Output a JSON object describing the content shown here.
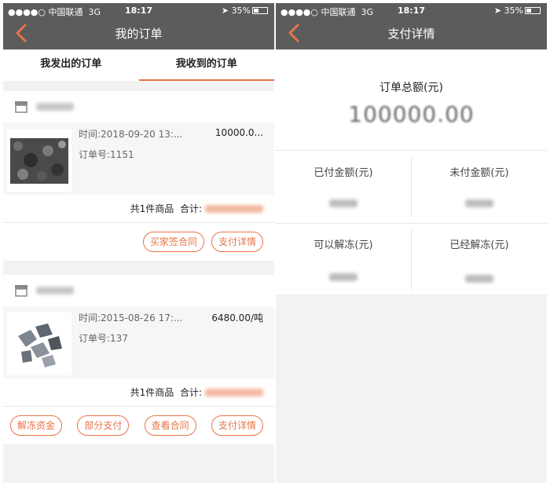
{
  "status_bar": {
    "carrier": "●●●●○ 中国联通",
    "network": "3G",
    "time": "18:17",
    "battery": "35%"
  },
  "left": {
    "nav_title": "我的订单",
    "tabs": [
      {
        "label": "我发出的订单",
        "active": false
      },
      {
        "label": "我收到的订单",
        "active": true
      }
    ],
    "orders": [
      {
        "time": "时间:2018-09-20 13:...",
        "price": "10000.0...",
        "order_no": "订单号:1151",
        "count_text": "共1件商品",
        "total_label": "合计:",
        "buttons": [
          "买家签合同",
          "支付详情"
        ]
      },
      {
        "time": "时间:2015-08-26 17:...",
        "price": "6480.00/吨",
        "order_no": "订单号:137",
        "count_text": "共1件商品",
        "total_label": "合计:",
        "buttons": [
          "解冻资金",
          "部分支付",
          "查看合同",
          "支付详情"
        ]
      }
    ]
  },
  "right": {
    "nav_title": "支付详情",
    "total_label": "订单总额(元)",
    "total_value": "100000.00",
    "cells": [
      {
        "label": "已付金额(元)"
      },
      {
        "label": "未付金额(元)"
      },
      {
        "label": "可以解冻(元)"
      },
      {
        "label": "已经解冻(元)"
      }
    ]
  },
  "colors": {
    "nav_bg": "#5c5c5c",
    "accent": "#e8744a",
    "page_bg": "#f2f2f2"
  }
}
